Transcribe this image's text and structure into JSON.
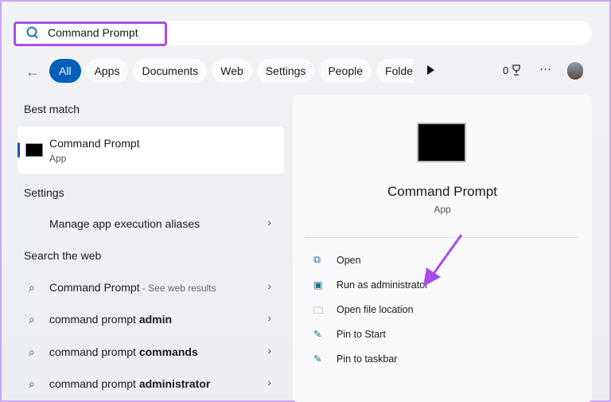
{
  "search": {
    "value": "Command Prompt"
  },
  "filters": {
    "back": "←",
    "chips": [
      "All",
      "Apps",
      "Documents",
      "Web",
      "Settings",
      "People",
      "Folders"
    ],
    "points": "0"
  },
  "left": {
    "best_match_heading": "Best match",
    "best_match": {
      "title": "Command Prompt",
      "subtitle": "App"
    },
    "settings_heading": "Settings",
    "settings_items": [
      "Manage app execution aliases"
    ],
    "web_heading": "Search the web",
    "web_items": [
      {
        "text": "Command Prompt",
        "suffix": " - See web results"
      },
      {
        "text": "command prompt ",
        "bold": "admin"
      },
      {
        "text": "command prompt ",
        "bold": "commands"
      },
      {
        "text": "command prompt ",
        "bold": "administrator"
      }
    ]
  },
  "right": {
    "title": "Command Prompt",
    "subtitle": "App",
    "actions": [
      {
        "label": "Open",
        "icon": "open-external-icon"
      },
      {
        "label": "Run as administrator",
        "icon": "shield-window-icon"
      },
      {
        "label": "Open file location",
        "icon": "folder-icon"
      },
      {
        "label": "Pin to Start",
        "icon": "pin-icon"
      },
      {
        "label": "Pin to taskbar",
        "icon": "pin-icon"
      }
    ]
  },
  "colors": {
    "accent": "#005fb8",
    "highlight": "#a94de8"
  }
}
